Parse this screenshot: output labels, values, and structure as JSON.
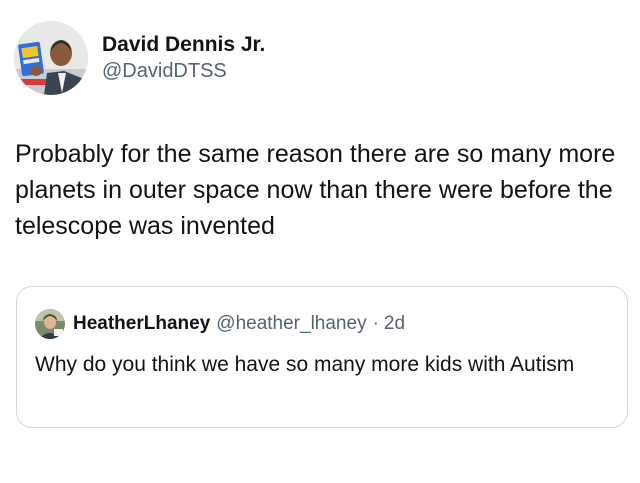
{
  "tweet": {
    "author": {
      "display_name": "David Dennis Jr.",
      "handle": "@DavidDTSS",
      "avatar_icon": "profile-photo"
    },
    "text": "Probably for the same reason there are so many more planets in outer space now than there were before the telescope was invented"
  },
  "quoted_tweet": {
    "author": {
      "display_name": "HeatherLhaney",
      "handle": "@heather_lhaney",
      "avatar_icon": "profile-photo"
    },
    "separator": "·",
    "time": "2d",
    "text": "Why do you think we have so many more kids with Autism"
  },
  "colors": {
    "primary_text": "#0f1419",
    "secondary_text": "#536471",
    "border": "#cfd9de"
  }
}
